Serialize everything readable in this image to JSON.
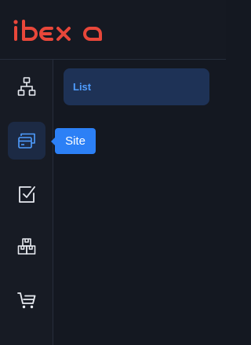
{
  "header": {
    "logo_text": "ibexa",
    "logo_icon": "ibexa-logo",
    "brand_color": "#e8473a"
  },
  "sidebar": {
    "items": [
      {
        "icon": "sitemap-icon",
        "active": false
      },
      {
        "icon": "site-card-icon",
        "active": true
      },
      {
        "icon": "checkbox-icon",
        "active": false
      },
      {
        "icon": "boxes-icon",
        "active": false
      },
      {
        "icon": "cart-icon",
        "active": false
      }
    ]
  },
  "flyout": {
    "items": [
      {
        "label": "List"
      }
    ]
  },
  "tooltip": {
    "label": "Site"
  },
  "colors": {
    "accent": "#4f9dff",
    "tooltip_bg": "#2c80f6",
    "active_bg": "#1c2a44"
  }
}
